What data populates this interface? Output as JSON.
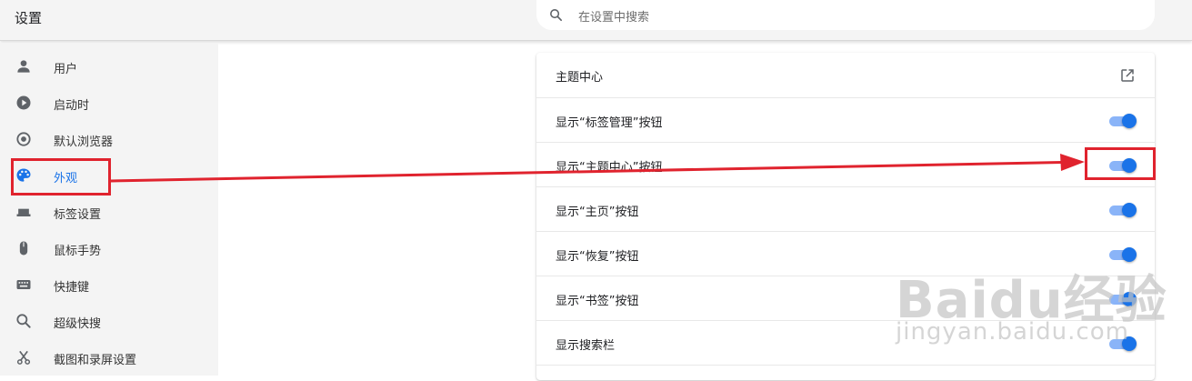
{
  "app": {
    "title": "设置"
  },
  "search": {
    "placeholder": "在设置中搜索",
    "icon": "search-icon"
  },
  "sidebar": {
    "items": [
      {
        "label": "用户",
        "icon": "person-icon",
        "active": false
      },
      {
        "label": "启动时",
        "icon": "play-circle-icon",
        "active": false
      },
      {
        "label": "默认浏览器",
        "icon": "target-icon",
        "active": false
      },
      {
        "label": "外观",
        "icon": "palette-icon",
        "active": true
      },
      {
        "label": "标签设置",
        "icon": "tab-icon",
        "active": false
      },
      {
        "label": "鼠标手势",
        "icon": "mouse-icon",
        "active": false
      },
      {
        "label": "快捷键",
        "icon": "keyboard-icon",
        "active": false
      },
      {
        "label": "超级快搜",
        "icon": "search-icon",
        "active": false
      },
      {
        "label": "截图和录屏设置",
        "icon": "scissors-icon",
        "active": false
      }
    ]
  },
  "settings": {
    "rows": [
      {
        "label": "主题中心",
        "control": "external-link",
        "icon": "external-link-icon"
      },
      {
        "label": "显示“标签管理”按钮",
        "control": "toggle",
        "on": true
      },
      {
        "label": "显示“主题中心”按钮",
        "control": "toggle",
        "on": true
      },
      {
        "label": "显示“主页”按钮",
        "control": "toggle",
        "on": true
      },
      {
        "label": "显示“恢复”按钮",
        "control": "toggle",
        "on": true
      },
      {
        "label": "显示“书签”按钮",
        "control": "toggle",
        "on": true
      },
      {
        "label": "显示搜索栏",
        "control": "toggle",
        "on": true
      }
    ]
  },
  "watermark": {
    "brand": "Baidu经验",
    "url": "jingyan.baidu.com"
  },
  "colors": {
    "accent": "#1a73e8",
    "toggle_track": "#8ab4f8",
    "annotation": "#e0232e",
    "sidebar_bg": "#f4f4f4"
  }
}
